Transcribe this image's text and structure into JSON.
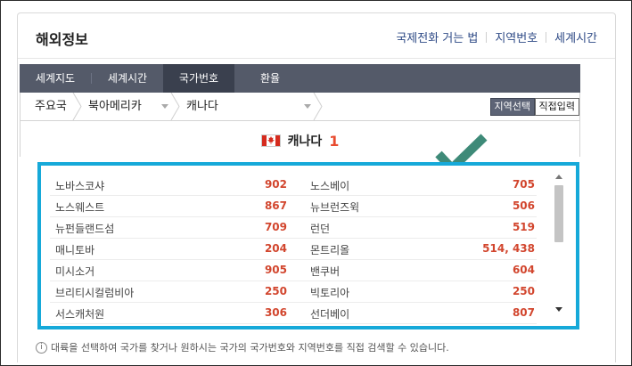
{
  "header": {
    "title": "해외정보",
    "links": [
      "국제전화 거는 법",
      "지역번호",
      "세계시간"
    ]
  },
  "tabs": [
    {
      "label": "세계지도",
      "active": false
    },
    {
      "label": "세계시간",
      "active": false
    },
    {
      "label": "국가번호",
      "active": true
    },
    {
      "label": "환율",
      "active": false
    }
  ],
  "selector": {
    "level1": "주요국",
    "level2": "북아메리카",
    "level3": "캐나다",
    "btn_region": "지역선택",
    "btn_direct": "직접입력"
  },
  "country": {
    "name": "캐나다",
    "code": "1"
  },
  "regions": [
    {
      "name": "노바스코샤",
      "code": "902"
    },
    {
      "name": "노스베이",
      "code": "705"
    },
    {
      "name": "노스웨스트",
      "code": "867"
    },
    {
      "name": "뉴브런즈윅",
      "code": "506"
    },
    {
      "name": "뉴펀들랜드섬",
      "code": "709"
    },
    {
      "name": "런던",
      "code": "519"
    },
    {
      "name": "매니토바",
      "code": "204"
    },
    {
      "name": "몬트리올",
      "code": "514, 438"
    },
    {
      "name": "미시소거",
      "code": "905"
    },
    {
      "name": "밴쿠버",
      "code": "604"
    },
    {
      "name": "브리티시컬럼비아",
      "code": "250"
    },
    {
      "name": "빅토리아",
      "code": "250"
    },
    {
      "name": "서스캐처원",
      "code": "306"
    },
    {
      "name": "선더베이",
      "code": "807"
    }
  ],
  "help_text": "대륙을 선택하여 국가를 찾거나 원하시는 국가의 국가번호와 지역번호를 직접 검색할 수 있습니다.",
  "colors": {
    "highlight_frame": "#16a9d9",
    "checkmark": "#3e8a78",
    "code_text": "#d2462e",
    "tab_bg": "#545a69"
  }
}
